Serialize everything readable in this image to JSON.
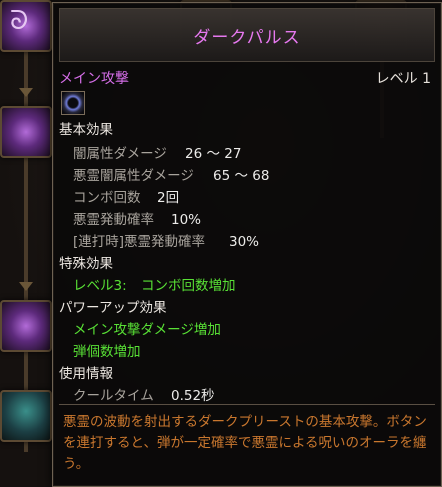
{
  "tooltip": {
    "title": "ダークパルス",
    "main_label": "メイン攻撃",
    "level": "レベル 1",
    "skill_icon": "dark-orb-icon",
    "basic_effects": {
      "header": "基本効果",
      "rows": [
        {
          "label": "闇属性ダメージ",
          "value": "26 ～ 27"
        },
        {
          "label": "悪霊闇属性ダメージ",
          "value": "65 ～ 68"
        },
        {
          "label": "コンボ回数",
          "value": "2回"
        },
        {
          "label": "悪霊発動確率",
          "value": "10%"
        },
        {
          "label": "[連打時]悪霊発動確率",
          "value": "30%"
        }
      ]
    },
    "special_effects": {
      "header": "特殊効果",
      "rows": [
        {
          "level": "レベル3:",
          "text": "コンボ回数増加"
        }
      ]
    },
    "powerup_effects": {
      "header": "パワーアップ効果",
      "rows": [
        {
          "text": "メイン攻撃ダメージ増加"
        },
        {
          "text": "弾個数増加"
        }
      ]
    },
    "usage_info": {
      "header": "使用情報",
      "rows": [
        {
          "label": "クールタイム",
          "value": "0.52秒"
        }
      ]
    },
    "description": "悪霊の波動を射出するダークプリーストの基本攻撃。ボタンを連打すると、弾が一定確率で悪霊による呪いのオーラを纏う。",
    "colors": {
      "title": "#e678ef",
      "main_label": "#d56ee8",
      "effect_green": "#58e035",
      "description": "#c9772e"
    }
  },
  "skill_tree": {
    "nodes": [
      {
        "name": "rune-skill-node",
        "icon": "rune-icon",
        "glyph": "ᘐ"
      },
      {
        "name": "purple-orb-skill-node-1",
        "icon": "purple-orb-icon"
      },
      {
        "name": "purple-orb-skill-node-2",
        "icon": "purple-orb-icon"
      },
      {
        "name": "teal-creature-skill-node",
        "icon": "teal-creature-icon"
      },
      {
        "name": "dark-skill-node",
        "icon": "dark-orb-icon"
      },
      {
        "name": "orange-skill-node",
        "icon": "orange-flame-icon"
      }
    ]
  }
}
